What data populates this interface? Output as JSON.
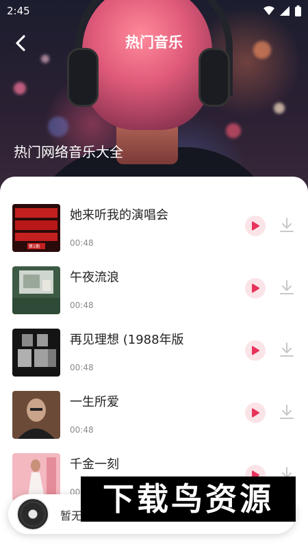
{
  "status": {
    "time": "2:45",
    "icons": [
      "wifi-icon",
      "signal-icon",
      "battery-icon"
    ]
  },
  "header": {
    "title": "热门音乐",
    "subtitle": "热门网络音乐大全",
    "back_icon": "chevron-left-icon"
  },
  "songs": [
    {
      "title": "她来听我的演唱会",
      "duration": "00:48",
      "cover": "red-album-cover",
      "cover_label": "第1期"
    },
    {
      "title": "午夜流浪",
      "duration": "00:48",
      "cover": "green-album-cover"
    },
    {
      "title": "再见理想 (1988年版",
      "duration": "00:48",
      "cover": "band-photo-cover"
    },
    {
      "title": "一生所爱",
      "duration": "00:48",
      "cover": "portrait-cover"
    },
    {
      "title": "千金一刻",
      "duration": "00:48",
      "cover": "pink-album-cover"
    }
  ],
  "player": {
    "text": "暂无"
  },
  "watermark": {
    "text": "下载鸟资源"
  },
  "colors": {
    "accent": "#e8335a",
    "play_bg": "#fbe4e8",
    "download": "#c8c8c8"
  }
}
